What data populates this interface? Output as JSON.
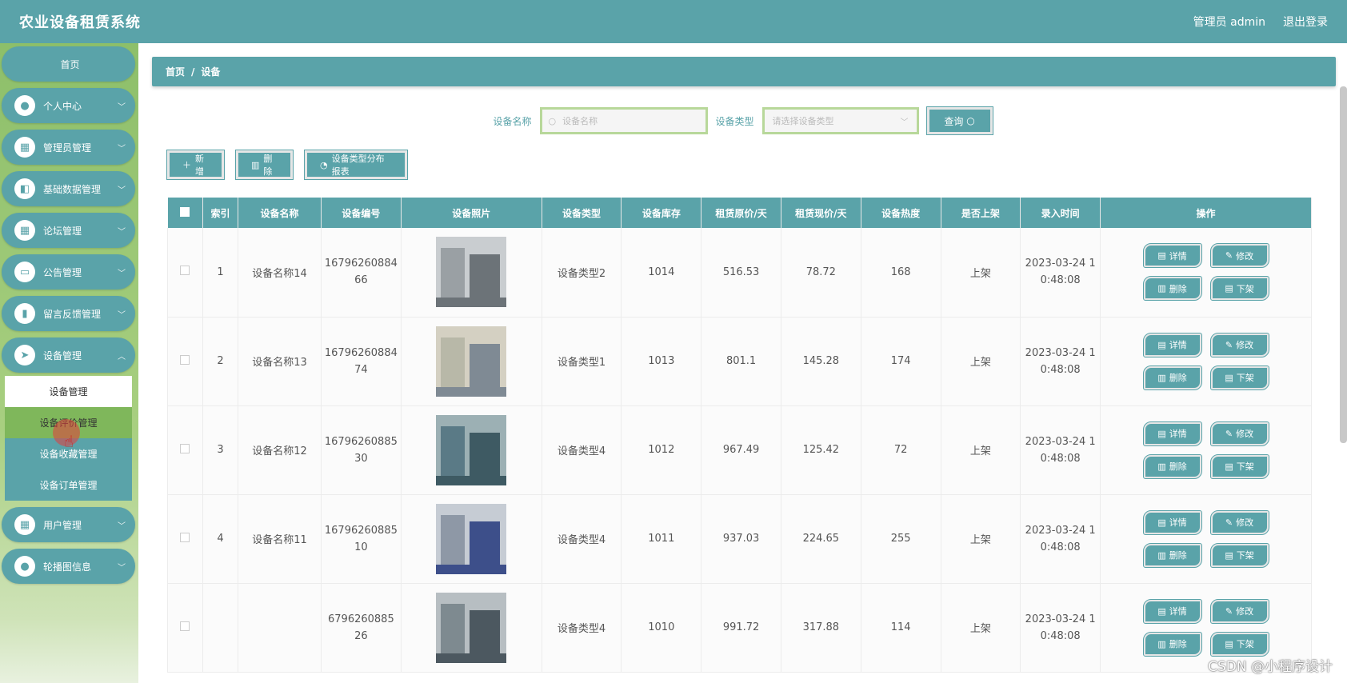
{
  "app": {
    "title": "农业设备租赁系统"
  },
  "header": {
    "user_label": "管理员 admin",
    "logout_label": "退出登录"
  },
  "sidebar": {
    "home": "首页",
    "items": [
      {
        "label": "个人中心",
        "icon": "person"
      },
      {
        "label": "管理员管理",
        "icon": "grid"
      },
      {
        "label": "基础数据管理",
        "icon": "box"
      },
      {
        "label": "论坛管理",
        "icon": "grid"
      },
      {
        "label": "公告管理",
        "icon": "monitor"
      },
      {
        "label": "留言反馈管理",
        "icon": "bar-chart"
      },
      {
        "label": "设备管理",
        "icon": "send"
      },
      {
        "label": "用户管理",
        "icon": "grid"
      },
      {
        "label": "轮播图信息",
        "icon": "person"
      }
    ],
    "submenu": [
      "设备管理",
      "设备评价管理",
      "设备收藏管理",
      "设备订单管理"
    ]
  },
  "breadcrumb": {
    "home": "首页",
    "sep": "/",
    "current": "设备"
  },
  "search": {
    "name_label": "设备名称",
    "name_placeholder": "设备名称",
    "type_label": "设备类型",
    "type_placeholder": "请选择设备类型",
    "query_label": "查询"
  },
  "actions": {
    "add": "新增",
    "delete": "删除",
    "report": "设备类型分布报表"
  },
  "table": {
    "headers": [
      "索引",
      "设备名称",
      "设备编号",
      "设备照片",
      "设备类型",
      "设备库存",
      "租赁原价/天",
      "租赁现价/天",
      "设备热度",
      "是否上架",
      "录入时间",
      "操作"
    ],
    "ops": {
      "detail": "详情",
      "edit": "修改",
      "delete": "删除",
      "unlist": "下架"
    },
    "rows": [
      {
        "idx": "1",
        "name": "设备名称14",
        "code_a": "16796260884",
        "code_b": "66",
        "type": "设备类型2",
        "stock": "1014",
        "orig": "516.53",
        "now": "78.72",
        "heat": "168",
        "listed": "上架",
        "time_a": "2023-03-24 1",
        "time_b": "0:48:08"
      },
      {
        "idx": "2",
        "name": "设备名称13",
        "code_a": "16796260884",
        "code_b": "74",
        "type": "设备类型1",
        "stock": "1013",
        "orig": "801.1",
        "now": "145.28",
        "heat": "174",
        "listed": "上架",
        "time_a": "2023-03-24 1",
        "time_b": "0:48:08"
      },
      {
        "idx": "3",
        "name": "设备名称12",
        "code_a": "16796260885",
        "code_b": "30",
        "type": "设备类型4",
        "stock": "1012",
        "orig": "967.49",
        "now": "125.42",
        "heat": "72",
        "listed": "上架",
        "time_a": "2023-03-24 1",
        "time_b": "0:48:08"
      },
      {
        "idx": "4",
        "name": "设备名称11",
        "code_a": "16796260885",
        "code_b": "10",
        "type": "设备类型4",
        "stock": "1011",
        "orig": "937.03",
        "now": "224.65",
        "heat": "255",
        "listed": "上架",
        "time_a": "2023-03-24 1",
        "time_b": "0:48:08"
      },
      {
        "idx": "",
        "name": "",
        "code_a": "6796260885",
        "code_b": "26",
        "type": "设备类型4",
        "stock": "1010",
        "orig": "991.72",
        "now": "317.88",
        "heat": "114",
        "listed": "上架",
        "time_a": "2023-03-24 1",
        "time_b": "0:48:08"
      }
    ]
  },
  "watermark": "CSDN @小程序设计"
}
